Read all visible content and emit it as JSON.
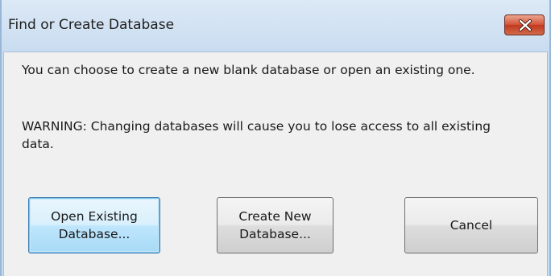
{
  "window": {
    "title": "Find or Create Database"
  },
  "message": {
    "line1": "You can choose to create a new blank database or open an existing one.",
    "line2": "WARNING: Changing databases will cause you to lose access to all existing data."
  },
  "buttons": {
    "open_existing": "Open Existing\nDatabase...",
    "create_new": "Create New\nDatabase...",
    "cancel": "Cancel"
  },
  "icons": {
    "close": "close-icon"
  },
  "colors": {
    "close_button": "#c7442a",
    "title_bar": "#c9dcf0",
    "client_background": "#f0f0f0",
    "default_button_border": "#3c7fb1"
  }
}
